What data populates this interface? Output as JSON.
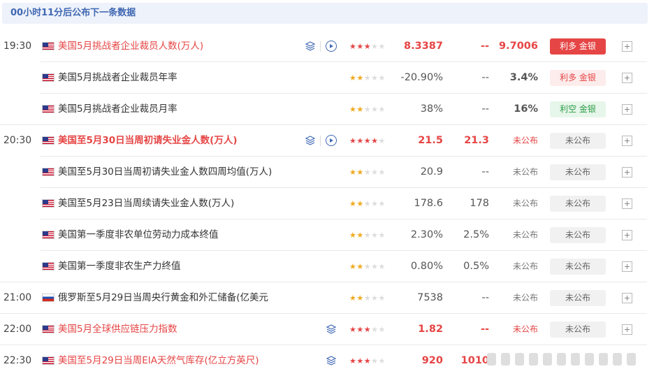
{
  "countdown": "00小时11分后公布下一条数据",
  "icons": {
    "layers": "layers-icon",
    "play": "play-circle-icon",
    "expand": "plus-square-icon"
  },
  "colors": {
    "bullish": "#e64545",
    "bearish": "#2c9e48",
    "accent": "#3f67b3",
    "star_gold": "#f0a920"
  },
  "rows": [
    {
      "time": "19:30",
      "country": "US",
      "name": "美国5月挑战者企业裁员人数(万人)",
      "importance": 3,
      "previous": "8.3387",
      "forecast": "--",
      "actual": "9.7006",
      "impact": "利多 金银"
    },
    {
      "time": "",
      "country": "US",
      "name": "美国5月挑战者企业裁员年率",
      "importance": 2,
      "previous": "-20.90%",
      "forecast": "--",
      "actual": "3.4%",
      "impact": "利多 金银"
    },
    {
      "time": "",
      "country": "US",
      "name": "美国5月挑战者企业裁员月率",
      "importance": 2,
      "previous": "38%",
      "forecast": "--",
      "actual": "16%",
      "impact": "利空 金银"
    },
    {
      "time": "20:30",
      "country": "US",
      "name": "美国至5月30日当周初请失业金人数(万人)",
      "importance": 4,
      "previous": "21.5",
      "forecast": "21.3",
      "actual": "未公布",
      "impact": "未公布"
    },
    {
      "time": "",
      "country": "US",
      "name": "美国至5月30日当周初请失业金人数四周均值(万人)",
      "importance": 2,
      "previous": "20.9",
      "forecast": "--",
      "actual": "未公布",
      "impact": "未公布"
    },
    {
      "time": "",
      "country": "US",
      "name": "美国至5月23日当周续请失业金人数(万人)",
      "importance": 2,
      "previous": "178.6",
      "forecast": "178",
      "actual": "未公布",
      "impact": "未公布"
    },
    {
      "time": "",
      "country": "US",
      "name": "美国第一季度非农单位劳动力成本终值",
      "importance": 2,
      "previous": "2.30%",
      "forecast": "2.5%",
      "actual": "未公布",
      "impact": "未公布"
    },
    {
      "time": "",
      "country": "US",
      "name": "美国第一季度非农生产力终值",
      "importance": 2,
      "previous": "0.80%",
      "forecast": "0.5%",
      "actual": "未公布",
      "impact": "未公布"
    },
    {
      "time": "21:00",
      "country": "RU",
      "name": "俄罗斯至5月29日当周央行黄金和外汇储备(亿美元",
      "importance": 2,
      "previous": "7538",
      "forecast": "--",
      "actual": "未公布",
      "impact": "未公布"
    },
    {
      "time": "22:00",
      "country": "US",
      "name": "美国5月全球供应链压力指数",
      "importance": 3,
      "previous": "1.82",
      "forecast": "--",
      "actual": "未公布",
      "impact": "未公布"
    },
    {
      "time": "22:30",
      "country": "US",
      "name": "美国至5月29日当周EIA天然气库存(亿立方英尺)",
      "importance": 3,
      "previous": "920",
      "forecast": "1010",
      "actual": "",
      "impact": ""
    }
  ]
}
